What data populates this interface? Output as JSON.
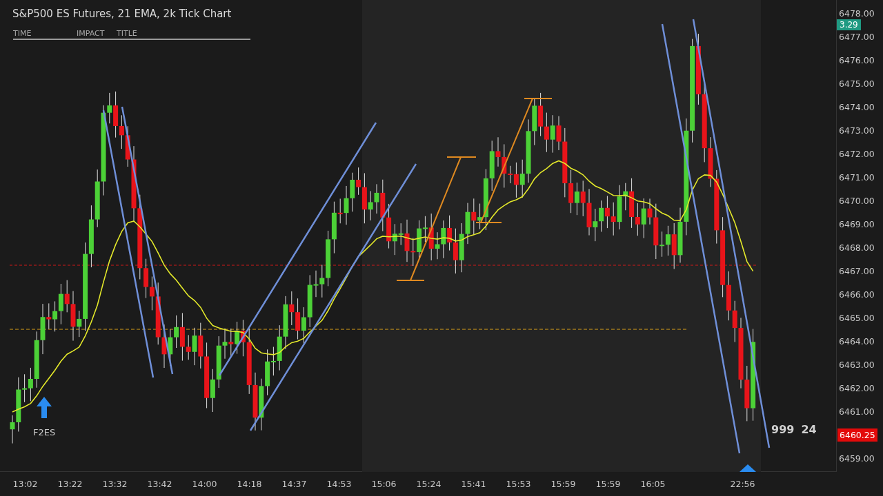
{
  "chart_title": "S&P500 ES Futures, 21 EMA, 2k Tick Chart",
  "news_panel": {
    "columns": [
      "TIME",
      "IMPACT",
      "TITLE"
    ]
  },
  "signal_label": "F2ES",
  "volume_readout": [
    "999",
    "24"
  ],
  "change_badge": "3.29",
  "price_axis": [
    {
      "text": "6478.00",
      "kind": "tick"
    },
    {
      "text": "6477.00",
      "kind": "tick"
    },
    {
      "text": "6476.00",
      "kind": "tick"
    },
    {
      "text": "6475.00",
      "kind": "tick"
    },
    {
      "text": "6474.00",
      "kind": "tick"
    },
    {
      "text": "6473.00",
      "kind": "tick"
    },
    {
      "text": "6472.00",
      "kind": "tick"
    },
    {
      "text": "6471.00",
      "kind": "tick"
    },
    {
      "text": "6470.00",
      "kind": "tick"
    },
    {
      "text": "6469.00",
      "kind": "tick"
    },
    {
      "text": "6468.00",
      "kind": "tick"
    },
    {
      "text": "6467.00",
      "kind": "tick"
    },
    {
      "text": "6466.00",
      "kind": "tick"
    },
    {
      "text": "6465.00",
      "kind": "tick"
    },
    {
      "text": "6464.00",
      "kind": "tick"
    },
    {
      "text": "6463.00",
      "kind": "tick"
    },
    {
      "text": "6462.00",
      "kind": "tick"
    },
    {
      "text": "6461.00",
      "kind": "tick"
    },
    {
      "text": "6460.25",
      "kind": "last"
    },
    {
      "text": "6459.00",
      "kind": "tick"
    }
  ],
  "time_axis": [
    "13:02",
    "13:22",
    "13:32",
    "13:42",
    "14:00",
    "14:18",
    "14:37",
    "14:53",
    "15:06",
    "15:24",
    "15:41",
    "15:53",
    "15:59",
    "15:59",
    "16:05",
    "22:56"
  ]
}
